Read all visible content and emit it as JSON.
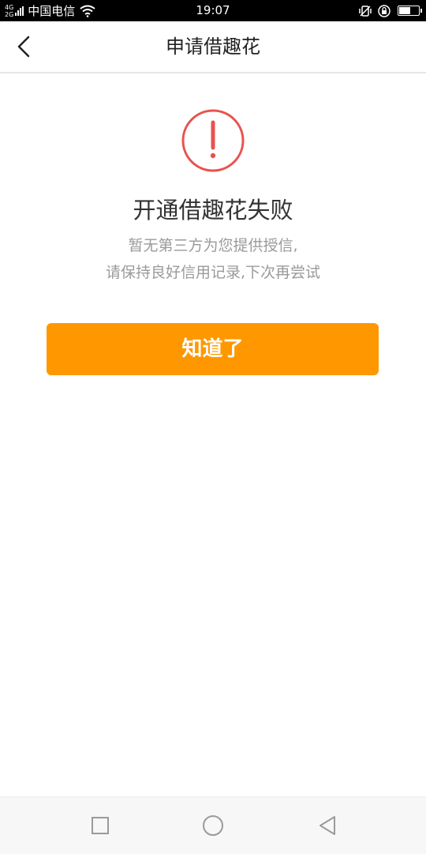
{
  "status_bar": {
    "network_top": "4G",
    "network_bottom": "2G",
    "carrier": "中国电信",
    "time": "19:07",
    "battery_level": 0.6
  },
  "header": {
    "title": "申请借趣花"
  },
  "result": {
    "title": "开通借趣花失败",
    "message_line1": "暂无第三方为您提供授信,",
    "message_line2": "请保持良好信用记录,下次再尝试"
  },
  "actions": {
    "confirm_label": "知道了"
  },
  "colors": {
    "accent": "#ff9800",
    "alert": "#e9534f",
    "title_text": "#333333",
    "muted_text": "#9a9a9a"
  }
}
